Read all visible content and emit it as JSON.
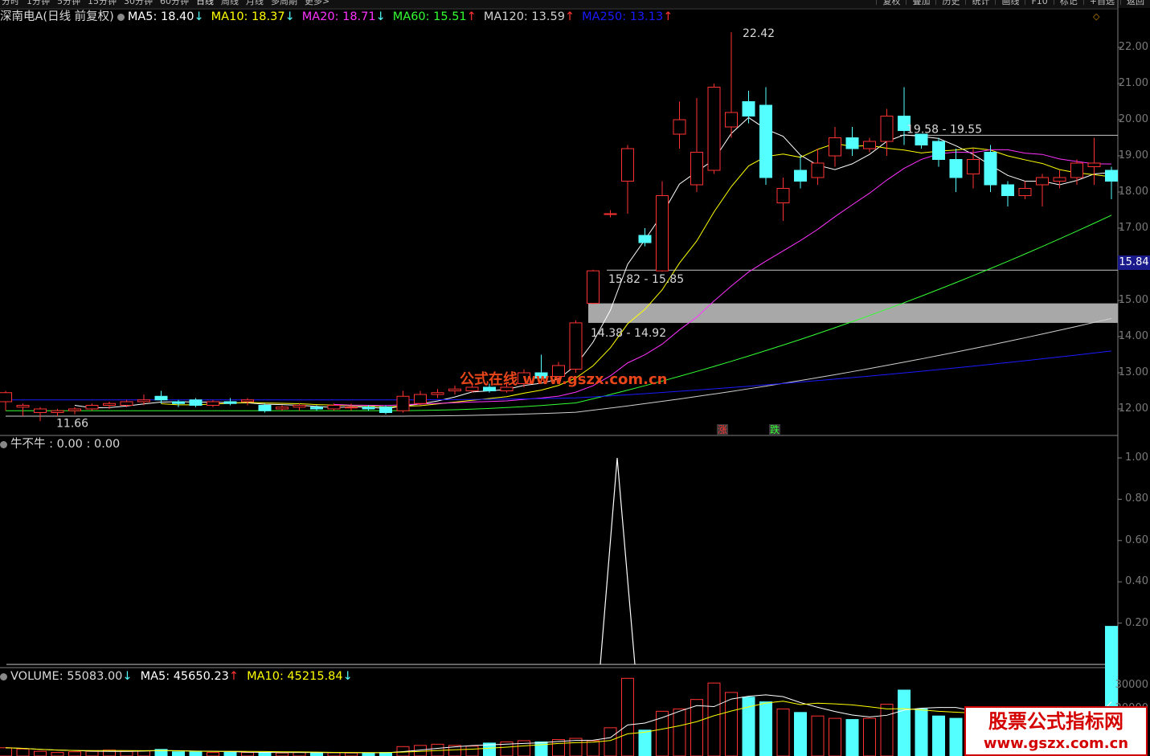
{
  "toolbar": {
    "periods": [
      "分时",
      "1分钟",
      "5分钟",
      "15分钟",
      "30分钟",
      "60分钟",
      "日线",
      "周线",
      "月线",
      "多周期",
      "更多>"
    ],
    "active_period": "日线",
    "right_buttons": [
      "复权",
      "叠加",
      "历史",
      "统计",
      "画线",
      "F10",
      "标记",
      "+自选",
      "返回"
    ]
  },
  "price_panel": {
    "title": "深南电A(日线 前复权)",
    "ma": [
      {
        "label": "MA5: 18.40",
        "arrow": "↓",
        "color": "#ffffff"
      },
      {
        "label": "MA10: 18.37",
        "arrow": "↓",
        "color": "#ffff00"
      },
      {
        "label": "MA20: 18.71",
        "arrow": "↓",
        "color": "#ff33ff"
      },
      {
        "label": "MA60: 15.51",
        "arrow": "↑",
        "color": "#33ff33"
      },
      {
        "label": "MA120: 13.59",
        "arrow": "↑",
        "color": "#d0d0d0"
      },
      {
        "label": "MA250: 13.13",
        "arrow": "↑",
        "color": "#1a1aff"
      }
    ],
    "y_ticks": [
      "22.00",
      "21.00",
      "20.00",
      "19.00",
      "18.00",
      "17.00",
      "16.00",
      "15.00",
      "14.00",
      "13.00",
      "12.00"
    ],
    "current_price": "15.84",
    "high_label": "22.42",
    "low_label": "11.66",
    "zones": [
      "15.82 - 15.85",
      "14.38 - 14.92",
      "19.58 - 19.55"
    ],
    "signals": [
      "涨",
      "跌"
    ],
    "up_color": "#ff3232",
    "down_color": "#54ffff"
  },
  "indicator_panel": {
    "title": "牛不牛 : 0.00 : 0.00",
    "y_ticks": [
      "1.00",
      "0.80",
      "0.60",
      "0.40",
      "0.20"
    ]
  },
  "volume_panel": {
    "vol": {
      "label": "VOLUME: 55083.00",
      "arrow": "↓"
    },
    "ma5": {
      "label": "MA5: 45650.23",
      "arrow": "↑"
    },
    "ma10": {
      "label": "MA10: 45215.84",
      "arrow": "↓"
    },
    "y_ticks": [
      "30000",
      "20000"
    ]
  },
  "watermarks": {
    "center": "公式在线 www.gszx.com.cn",
    "corner_title": "股票公式指标网",
    "corner_url": "www.gszx.com.cn"
  },
  "chart_data": {
    "type": "candlestick",
    "candles": [
      [
        12.2,
        12.45,
        11.95,
        12.5
      ],
      [
        12.05,
        12.1,
        11.8,
        12.15
      ],
      [
        11.9,
        12.0,
        11.66,
        12.05
      ],
      [
        11.9,
        11.95,
        11.8,
        12.0
      ],
      [
        11.95,
        12.0,
        11.85,
        12.05
      ],
      [
        12.0,
        12.1,
        11.95,
        12.15
      ],
      [
        12.1,
        12.15,
        12.0,
        12.2
      ],
      [
        12.1,
        12.2,
        12.05,
        12.25
      ],
      [
        12.2,
        12.25,
        12.1,
        12.4
      ],
      [
        12.35,
        12.25,
        12.15,
        12.5
      ],
      [
        12.2,
        12.15,
        12.05,
        12.25
      ],
      [
        12.25,
        12.1,
        12.05,
        12.3
      ],
      [
        12.1,
        12.2,
        12.05,
        12.25
      ],
      [
        12.2,
        12.15,
        12.1,
        12.3
      ],
      [
        12.2,
        12.25,
        12.1,
        12.3
      ],
      [
        12.1,
        11.95,
        11.9,
        12.15
      ],
      [
        12.0,
        12.05,
        11.95,
        12.1
      ],
      [
        12.05,
        12.1,
        11.95,
        12.15
      ],
      [
        12.05,
        12.0,
        11.95,
        12.1
      ],
      [
        12.0,
        12.1,
        11.95,
        12.15
      ],
      [
        12.05,
        12.05,
        11.95,
        12.15
      ],
      [
        12.05,
        12.0,
        11.95,
        12.1
      ],
      [
        12.05,
        11.9,
        11.85,
        12.1
      ],
      [
        11.95,
        12.35,
        11.9,
        12.5
      ],
      [
        12.15,
        12.4,
        12.1,
        12.5
      ],
      [
        12.4,
        12.45,
        12.3,
        12.55
      ],
      [
        12.5,
        12.55,
        12.4,
        12.65
      ],
      [
        12.5,
        12.6,
        12.45,
        12.7
      ],
      [
        12.6,
        12.5,
        12.45,
        12.7
      ],
      [
        12.5,
        12.6,
        12.45,
        12.75
      ],
      [
        12.7,
        13.0,
        12.6,
        13.1
      ],
      [
        13.0,
        12.85,
        12.7,
        13.5
      ],
      [
        12.9,
        13.2,
        12.7,
        13.3
      ],
      [
        13.1,
        14.38,
        13.0,
        14.45
      ],
      [
        14.92,
        15.82,
        14.9,
        15.85
      ],
      [
        17.4,
        17.4,
        17.3,
        17.5
      ],
      [
        18.3,
        19.2,
        17.4,
        19.3
      ],
      [
        16.8,
        16.6,
        16.5,
        17.0
      ],
      [
        15.82,
        17.9,
        15.8,
        18.3
      ],
      [
        19.6,
        20.0,
        19.2,
        20.5
      ],
      [
        18.2,
        19.1,
        18.0,
        20.6
      ],
      [
        18.6,
        20.9,
        18.5,
        21.0
      ],
      [
        19.8,
        20.2,
        19.5,
        22.42
      ],
      [
        20.5,
        20.1,
        19.9,
        20.8
      ],
      [
        20.4,
        18.4,
        18.2,
        20.9
      ],
      [
        17.7,
        18.1,
        17.2,
        18.4
      ],
      [
        18.6,
        18.3,
        18.1,
        19.0
      ],
      [
        18.4,
        18.8,
        18.2,
        19.2
      ],
      [
        19.0,
        19.5,
        18.7,
        19.8
      ],
      [
        19.5,
        19.2,
        19.0,
        19.8
      ],
      [
        19.2,
        19.4,
        19.1,
        19.5
      ],
      [
        19.4,
        20.1,
        19.0,
        20.3
      ],
      [
        20.1,
        19.7,
        19.3,
        20.9
      ],
      [
        19.6,
        19.3,
        19.2,
        19.6
      ],
      [
        19.4,
        18.9,
        18.7,
        19.5
      ],
      [
        18.9,
        18.4,
        18.0,
        19.2
      ],
      [
        18.5,
        18.9,
        18.1,
        19.2
      ],
      [
        19.1,
        18.2,
        18.0,
        19.3
      ],
      [
        18.2,
        17.9,
        17.6,
        18.3
      ],
      [
        17.9,
        18.1,
        17.8,
        18.3
      ],
      [
        18.2,
        18.4,
        17.6,
        18.5
      ],
      [
        18.3,
        18.4,
        18.1,
        18.6
      ],
      [
        18.4,
        18.8,
        18.2,
        18.9
      ],
      [
        18.7,
        18.8,
        18.2,
        19.5
      ],
      [
        18.6,
        18.3,
        17.8,
        18.7
      ]
    ],
    "volume": [
      3500,
      3000,
      2000,
      1500,
      1800,
      2000,
      2500,
      2000,
      2200,
      2800,
      1800,
      1700,
      1500,
      1600,
      1500,
      1400,
      1300,
      1600,
      1500,
      1400,
      1300,
      1200,
      1500,
      4000,
      4500,
      5000,
      4500,
      4200,
      5500,
      6000,
      6500,
      6000,
      7000,
      7500,
      6500,
      12000,
      33000,
      11000,
      19000,
      20000,
      24000,
      31000,
      27000,
      25000,
      23000,
      20000,
      18500,
      17000,
      16000,
      15500,
      16000,
      22000,
      28000,
      20000,
      17000,
      16000,
      15000,
      15000,
      17000,
      16000,
      14500,
      15500,
      14000,
      16000,
      55083
    ]
  }
}
